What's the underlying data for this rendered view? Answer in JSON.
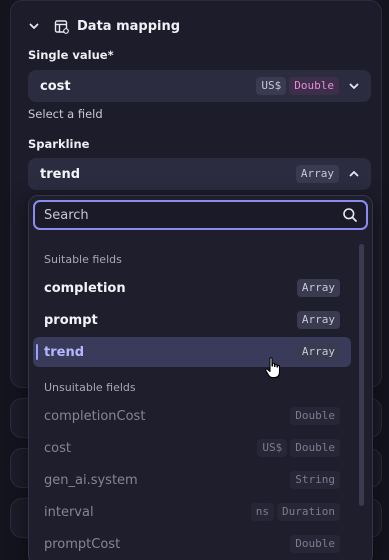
{
  "section": {
    "title": "Data mapping"
  },
  "single_value": {
    "label": "Single value*",
    "value": "cost",
    "tags": [
      "US$",
      "Double"
    ],
    "helper": "Select a field"
  },
  "sparkline": {
    "label": "Sparkline",
    "value": "trend",
    "tag": "Array"
  },
  "dropdown": {
    "search_placeholder": "Search",
    "suitable_label": "Suitable fields",
    "suitable": [
      {
        "name": "completion",
        "type": "Array"
      },
      {
        "name": "prompt",
        "type": "Array"
      },
      {
        "name": "trend",
        "type": "Array"
      }
    ],
    "unsuitable_label": "Unsuitable fields",
    "unsuitable": [
      {
        "name": "completionCost",
        "unit": "",
        "type": "Double"
      },
      {
        "name": "cost",
        "unit": "US$",
        "type": "Double"
      },
      {
        "name": "gen_ai.system",
        "unit": "",
        "type": "String"
      },
      {
        "name": "interval",
        "unit": "ns",
        "type": "Duration"
      },
      {
        "name": "promptCost",
        "unit": "",
        "type": "Double"
      }
    ]
  },
  "colors": {
    "accent": "#8b8cf0",
    "type_tag": "#e58bdf",
    "background": "#14141f"
  }
}
